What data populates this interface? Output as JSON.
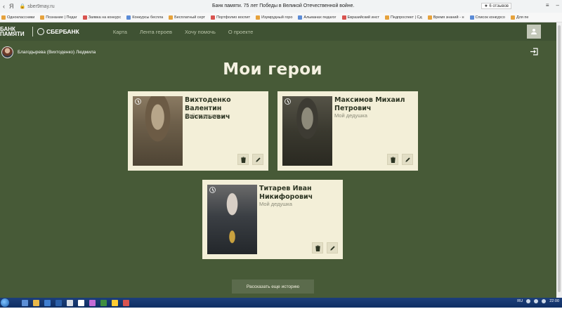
{
  "browser": {
    "url": "sber9may.ru",
    "page_title": "Банк памяти. 75 лет Победы в Великой Отечественной войне.",
    "reviews": "★ 6 отзывов",
    "bookmarks": [
      "Одноклассники",
      "Познание | Педаг",
      "Заявка на конкурс",
      "Конкурсы беспла",
      "Бесплатный серт",
      "Портфолио воспит",
      "Изумрудный горо",
      "Альманах педагог",
      "Евразийский инст",
      "Педпроспект | Сд",
      "Время знаний - н",
      "Список конкурсо",
      "Для пе"
    ]
  },
  "header": {
    "logo_bank": "БАНК ПАМЯТИ",
    "logo_sber": "СБЕРБАНК",
    "nav": [
      "Карта",
      "Лента героев",
      "Хочу помочь",
      "О проекте"
    ]
  },
  "profile": {
    "name": "Благодырева (Вихтоденко) Людмила"
  },
  "page": {
    "heading": "Мои герои",
    "cta_label": "Рассказать еще историю"
  },
  "heroes": [
    {
      "name": "Вихтоденко Валентин Васильевич",
      "relation": "Мой дедушка"
    },
    {
      "name": "Максимов Михаил Петрович",
      "relation": "Мой дедушка"
    },
    {
      "name": "Титарев Иван Никифорович",
      "relation": "Мой дедушка"
    }
  ],
  "icons": {
    "delete": "trash-icon",
    "edit": "pencil-icon",
    "logout": "logout-icon",
    "user": "user-icon",
    "photo_badge": "clock-icon"
  },
  "colors": {
    "header_bg": "#3f5233",
    "page_bg": "#475a37",
    "card_bg": "#f3efd8",
    "heading": "#f4f1e1",
    "cta_bg": "#5b6b4c"
  },
  "taskbar": {
    "lang": "RU",
    "time": "22:00"
  }
}
